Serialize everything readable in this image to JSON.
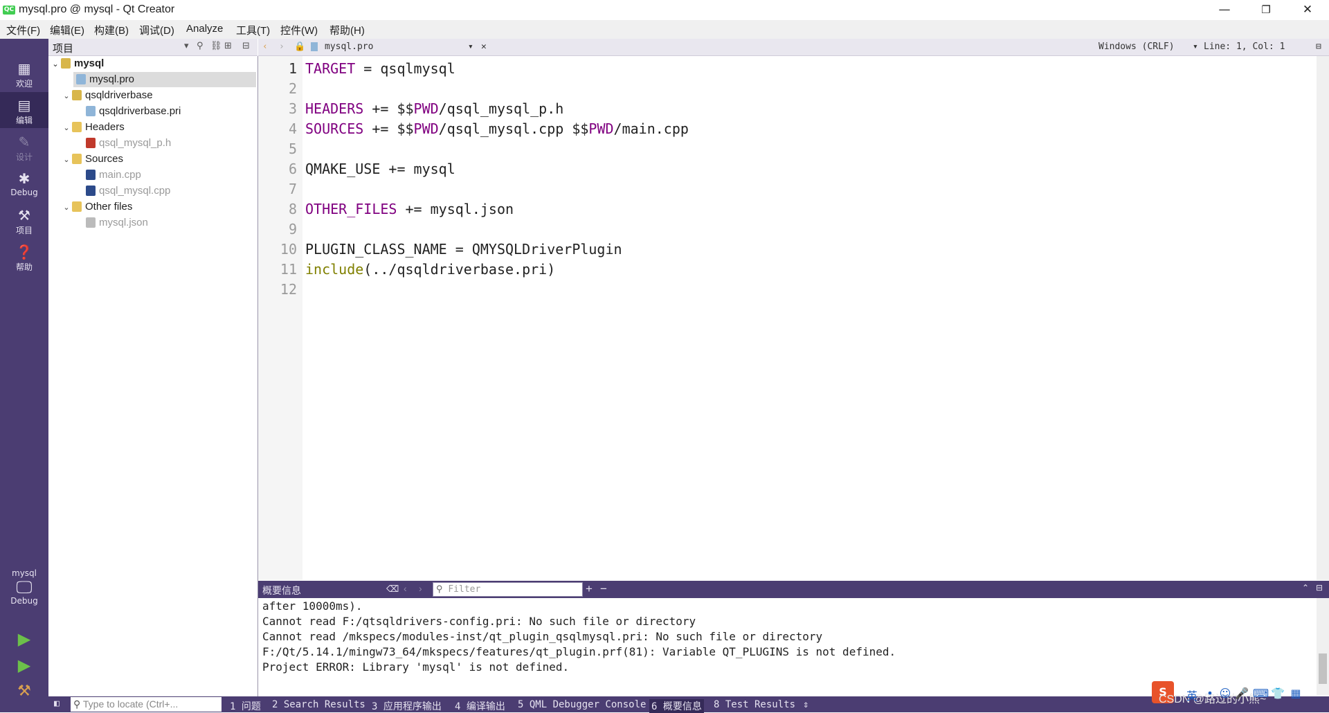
{
  "window": {
    "title": "mysql.pro @ mysql - Qt Creator",
    "logo_text": "QC",
    "controls": {
      "minimize": "—",
      "restore": "❐",
      "close": "✕"
    }
  },
  "menu": [
    "文件(F)",
    "编辑(E)",
    "构建(B)",
    "调试(D)",
    "Analyze",
    "工具(T)",
    "控件(W)",
    "帮助(H)"
  ],
  "modes": [
    {
      "label": "欢迎",
      "icon": "grid-icon"
    },
    {
      "label": "编辑",
      "icon": "edit-document-icon",
      "active": true
    },
    {
      "label": "设计",
      "icon": "pencil-icon",
      "disabled": true
    },
    {
      "label": "Debug",
      "icon": "bug-icon"
    },
    {
      "label": "项目",
      "icon": "wrench-icon"
    },
    {
      "label": "帮助",
      "icon": "help-icon"
    }
  ],
  "kit": {
    "project": "mysql",
    "config": "Debug"
  },
  "project_pane": {
    "title": "项目"
  },
  "tree": [
    {
      "label": "mysql",
      "level": 0,
      "expanded": true,
      "type": "project",
      "bold": true
    },
    {
      "label": "mysql.pro",
      "level": 1,
      "type": "pro",
      "selected": true
    },
    {
      "label": "qsqldriverbase",
      "level": 1,
      "expanded": true,
      "type": "project"
    },
    {
      "label": "qsqldriverbase.pri",
      "level": 2,
      "type": "pri"
    },
    {
      "label": "Headers",
      "level": 1,
      "expanded": true,
      "type": "headers"
    },
    {
      "label": "qsql_mysql_p.h",
      "level": 2,
      "type": "h",
      "dim": true
    },
    {
      "label": "Sources",
      "level": 1,
      "expanded": true,
      "type": "sources"
    },
    {
      "label": "main.cpp",
      "level": 2,
      "type": "cpp",
      "dim": true
    },
    {
      "label": "qsql_mysql.cpp",
      "level": 2,
      "type": "cpp",
      "dim": true
    },
    {
      "label": "Other files",
      "level": 1,
      "expanded": true,
      "type": "other"
    },
    {
      "label": "mysql.json",
      "level": 2,
      "type": "json",
      "dim": true
    }
  ],
  "editor": {
    "file_tab": "mysql.pro",
    "encoding": "Windows (CRLF)",
    "cursor": "Line: 1, Col: 1",
    "lines": [
      [
        {
          "t": "TARGET",
          "c": "kw"
        },
        {
          "t": " = qsqlmysql"
        }
      ],
      [],
      [
        {
          "t": "HEADERS",
          "c": "kw"
        },
        {
          "t": " += $$"
        },
        {
          "t": "PWD",
          "c": "kw"
        },
        {
          "t": "/qsql_mysql_p.h"
        }
      ],
      [
        {
          "t": "SOURCES",
          "c": "kw"
        },
        {
          "t": " += $$"
        },
        {
          "t": "PWD",
          "c": "kw"
        },
        {
          "t": "/qsql_mysql.cpp $$"
        },
        {
          "t": "PWD",
          "c": "kw"
        },
        {
          "t": "/main.cpp"
        }
      ],
      [],
      [
        {
          "t": "QMAKE_USE += mysql"
        }
      ],
      [],
      [
        {
          "t": "OTHER_FILES",
          "c": "kw"
        },
        {
          "t": " += mysql.json"
        }
      ],
      [],
      [
        {
          "t": "PLUGIN_CLASS_NAME = QMYSQLDriverPlugin"
        }
      ],
      [
        {
          "t": "include",
          "c": "fn"
        },
        {
          "t": "(../qsqldriverbase.pri)"
        }
      ],
      []
    ]
  },
  "output": {
    "title": "概要信息",
    "filter_placeholder": "Filter",
    "lines": [
      "after 10000ms).",
      "Cannot read F:/qtsqldrivers-config.pri: No such file or directory",
      "Cannot read /mkspecs/modules-inst/qt_plugin_qsqlmysql.pri: No such file or directory",
      "F:/Qt/5.14.1/mingw73_64/mkspecs/features/qt_plugin.prf(81): Variable QT_PLUGINS is not defined.",
      "Project ERROR: Library 'mysql' is not defined."
    ]
  },
  "statusbar": {
    "locate_placeholder": "Type to locate (Ctrl+...",
    "tabs": [
      "1 问题",
      "2 Search Results",
      "3 应用程序输出",
      "4 编译输出",
      "5 QML Debugger Console",
      "6 概要信息",
      "8 Test Results"
    ],
    "active_tab": 5
  },
  "watermark": "CSDN @路过的小熊~"
}
